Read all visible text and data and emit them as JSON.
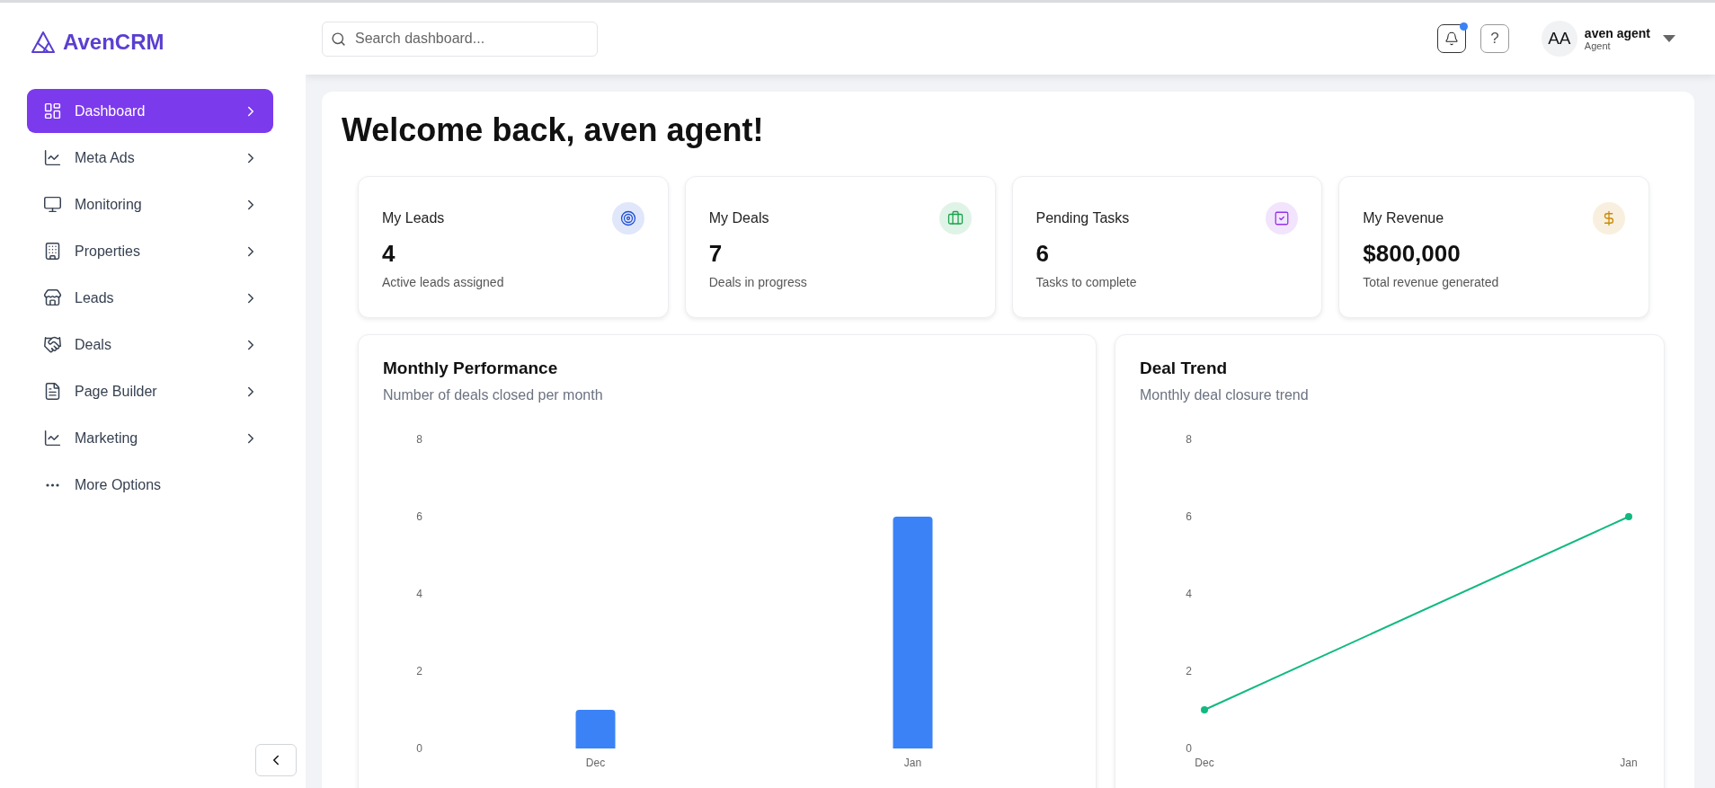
{
  "brand": {
    "name": "AvenCRM"
  },
  "sidebar": {
    "items": [
      {
        "label": "Dashboard",
        "selected": true
      },
      {
        "label": "Meta Ads",
        "selected": false
      },
      {
        "label": "Monitoring",
        "selected": false
      },
      {
        "label": "Properties",
        "selected": false
      },
      {
        "label": "Leads",
        "selected": false
      },
      {
        "label": "Deals",
        "selected": false
      },
      {
        "label": "Page Builder",
        "selected": false
      },
      {
        "label": "Marketing",
        "selected": false
      }
    ],
    "more": {
      "label": "More Options"
    }
  },
  "header": {
    "search": {
      "placeholder": "Search dashboard..."
    },
    "notifications": {
      "unread": true
    },
    "help": {
      "label": "?"
    },
    "user": {
      "initials": "AA",
      "name": "aven agent",
      "role": "Agent"
    }
  },
  "welcome": "Welcome back, aven agent!",
  "stats": [
    {
      "title": "My Leads",
      "value": "4",
      "caption": "Active leads assigned",
      "color": "#1d4ed8"
    },
    {
      "title": "My Deals",
      "value": "7",
      "caption": "Deals in progress",
      "color": "#16a34a"
    },
    {
      "title": "Pending Tasks",
      "value": "6",
      "caption": "Tasks to complete",
      "color": "#9333ea"
    },
    {
      "title": "My Revenue",
      "value": "$800,000",
      "caption": "Total revenue generated",
      "color": "#ca8a04"
    }
  ],
  "charts": [
    {
      "title": "Monthly Performance",
      "subtitle": "Number of deals closed per month",
      "chart_data": {
        "type": "bar",
        "categories": [
          "Dec",
          "Jan"
        ],
        "series": [
          {
            "color": "#3b82f6",
            "values": [
              1,
              6
            ]
          }
        ],
        "ylim": [
          0,
          8
        ],
        "yticks": [
          0,
          2,
          4,
          6,
          8
        ]
      }
    },
    {
      "title": "Deal Trend",
      "subtitle": "Monthly deal closure trend",
      "chart_data": {
        "type": "line",
        "categories": [
          "Dec",
          "Jan"
        ],
        "series": [
          {
            "color": "#10b981",
            "marker": "circle",
            "values": [
              1,
              6
            ]
          }
        ],
        "ylim": [
          0,
          8
        ],
        "yticks": [
          0,
          2,
          4,
          6,
          8
        ]
      }
    }
  ]
}
